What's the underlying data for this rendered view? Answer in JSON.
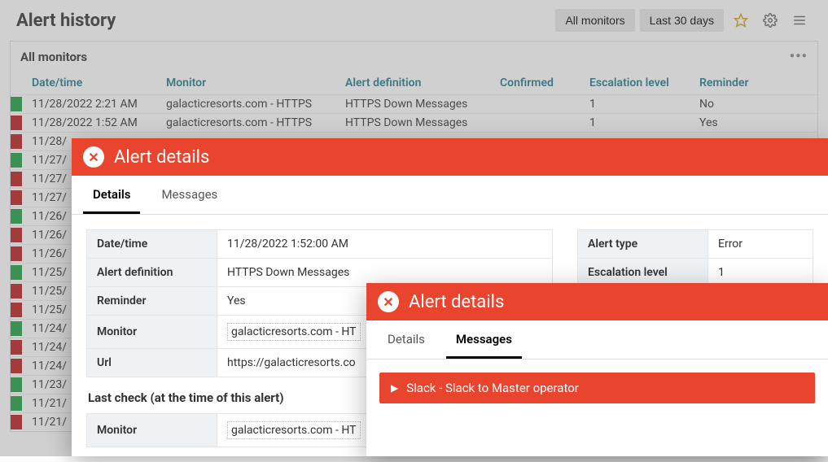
{
  "header": {
    "title": "Alert history",
    "filter_monitors": "All monitors",
    "filter_range": "Last 30 days"
  },
  "panel": {
    "title": "All monitors"
  },
  "columns": {
    "datetime": "Date/time",
    "monitor": "Monitor",
    "alertdef": "Alert definition",
    "confirmed": "Confirmed",
    "escalation": "Escalation level",
    "reminder": "Reminder"
  },
  "rows": [
    {
      "status": "green",
      "dt": "11/28/2022 2:21 AM",
      "mon": "galacticresorts.com - HTTPS",
      "def": "HTTPS Down Messages",
      "conf": "",
      "esc": "1",
      "rem": "No"
    },
    {
      "status": "red",
      "dt": "11/28/2022 1:52 AM",
      "mon": "galacticresorts.com - HTTPS",
      "def": "HTTPS Down Messages",
      "conf": "",
      "esc": "1",
      "rem": "Yes"
    },
    {
      "status": "red",
      "dt": "11/28/",
      "mon": "",
      "def": "",
      "conf": "",
      "esc": "",
      "rem": ""
    },
    {
      "status": "green",
      "dt": "11/27/",
      "mon": "",
      "def": "",
      "conf": "",
      "esc": "",
      "rem": ""
    },
    {
      "status": "red",
      "dt": "11/27/",
      "mon": "",
      "def": "",
      "conf": "",
      "esc": "",
      "rem": ""
    },
    {
      "status": "red",
      "dt": "11/27/",
      "mon": "",
      "def": "",
      "conf": "",
      "esc": "",
      "rem": ""
    },
    {
      "status": "green",
      "dt": "11/26/",
      "mon": "",
      "def": "",
      "conf": "",
      "esc": "",
      "rem": ""
    },
    {
      "status": "red",
      "dt": "11/26/",
      "mon": "",
      "def": "",
      "conf": "",
      "esc": "",
      "rem": ""
    },
    {
      "status": "red",
      "dt": "11/26/",
      "mon": "",
      "def": "",
      "conf": "",
      "esc": "",
      "rem": ""
    },
    {
      "status": "green",
      "dt": "11/25/",
      "mon": "",
      "def": "",
      "conf": "",
      "esc": "",
      "rem": ""
    },
    {
      "status": "red",
      "dt": "11/25/",
      "mon": "",
      "def": "",
      "conf": "",
      "esc": "",
      "rem": ""
    },
    {
      "status": "red",
      "dt": "11/25/",
      "mon": "",
      "def": "",
      "conf": "",
      "esc": "",
      "rem": ""
    },
    {
      "status": "green",
      "dt": "11/24/",
      "mon": "",
      "def": "",
      "conf": "",
      "esc": "",
      "rem": ""
    },
    {
      "status": "red",
      "dt": "11/24/",
      "mon": "",
      "def": "",
      "conf": "",
      "esc": "",
      "rem": ""
    },
    {
      "status": "red",
      "dt": "11/24/",
      "mon": "",
      "def": "",
      "conf": "",
      "esc": "",
      "rem": ""
    },
    {
      "status": "green",
      "dt": "11/23/",
      "mon": "",
      "def": "",
      "conf": "",
      "esc": "",
      "rem": ""
    },
    {
      "status": "green",
      "dt": "11/21/",
      "mon": "",
      "def": "",
      "conf": "",
      "esc": "",
      "rem": ""
    },
    {
      "status": "red",
      "dt": "11/21/",
      "mon": "",
      "def": "",
      "conf": "",
      "esc": "",
      "rem": ""
    }
  ],
  "modal1": {
    "title": "Alert details",
    "tabs": {
      "details": "Details",
      "messages": "Messages"
    },
    "fields": {
      "dt_lab": "Date/time",
      "dt_val": "11/28/2022 1:52:00 AM",
      "def_lab": "Alert definition",
      "def_val": "HTTPS Down Messages",
      "rem_lab": "Reminder",
      "rem_val": "Yes",
      "mon_lab": "Monitor",
      "mon_val": "galacticresorts.com - HT",
      "url_lab": "Url",
      "url_val": "https://galacticresorts.co",
      "type_lab": "Alert type",
      "type_val": "Error",
      "esc_lab": "Escalation level",
      "esc_val": "1"
    },
    "lastcheck_title": "Last check (at the time of this alert)",
    "lc_mon_lab": "Monitor",
    "lc_mon_val": "galacticresorts.com - HT"
  },
  "modal2": {
    "title": "Alert details",
    "tabs": {
      "details": "Details",
      "messages": "Messages"
    },
    "message": "Slack - Slack to Master operator"
  }
}
